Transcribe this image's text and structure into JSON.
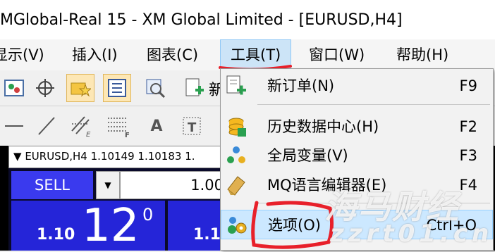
{
  "window": {
    "title": "MGlobal-Real 15 - XM Global Limited - [EURUSD,H4]"
  },
  "menubar": {
    "items": [
      {
        "label": "显示(V)"
      },
      {
        "label": "插入(I)"
      },
      {
        "label": "图表(C)"
      },
      {
        "label": "工具(T)",
        "active": true
      },
      {
        "label": "窗口(W)"
      },
      {
        "label": "帮助(H)"
      }
    ]
  },
  "toolbar": {
    "new_order_partial": "新",
    "text_tool": "A"
  },
  "tools_menu": {
    "items": [
      {
        "label": "新订单(N)",
        "shortcut": "F9",
        "icon": "new-order-icon"
      },
      {
        "label": "历史数据中心(H)",
        "shortcut": "F2",
        "icon": "history-center-icon"
      },
      {
        "label": "全局变量(V)",
        "shortcut": "F3",
        "icon": "global-variables-icon"
      },
      {
        "label": "MQ语言编辑器(E)",
        "shortcut": "F4",
        "icon": "metaeditor-icon"
      },
      {
        "label": "选项(O)",
        "shortcut": "Ctrl+O",
        "icon": "options-icon",
        "highlighted": true
      }
    ]
  },
  "one_click": {
    "header": "EURUSD,H4  1.10149 1.10183 1.",
    "sell_label": "SELL",
    "lot_value": "1.00",
    "sell_price_prefix": "1.10",
    "sell_price_main": "12",
    "sell_price_sup": "0",
    "buy_price_prefix": "1.1"
  },
  "watermark": {
    "line1": "海马财经",
    "line2": "zzrt01.cn"
  },
  "colors": {
    "accent_red": "#e8202a",
    "sell_blue": "#3a3aee",
    "menu_highlight": "#cce8ff"
  }
}
